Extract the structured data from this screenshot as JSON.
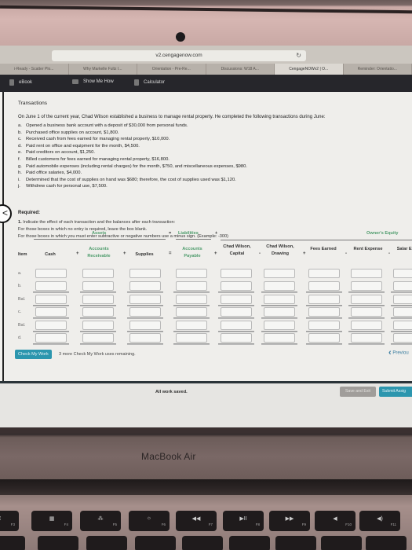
{
  "browser": {
    "url": "v2.cengagenow.com",
    "tabs": [
      {
        "label": "i-Ready - Scatter Plo...",
        "active": false
      },
      {
        "label": "Why Markelle Fultz I...",
        "active": false
      },
      {
        "label": "Orientation - Pre-Re...",
        "active": false
      },
      {
        "label": "Discussions: W18 A...",
        "active": false
      },
      {
        "label": "CengageNOWv2 | O...",
        "active": true
      },
      {
        "label": "Reminder: Orientatio...",
        "active": false
      }
    ]
  },
  "toolbar": {
    "ebook": "eBook",
    "show_me_how": "Show Me How",
    "calculator": "Calculator"
  },
  "problem": {
    "title": "Transactions",
    "intro": "On June 1 of the current year, Chad Wilson established a business to manage rental property. He completed the following transactions during June:",
    "transactions": [
      {
        "letter": "a.",
        "text": "Opened a business bank account with a deposit of $30,000 from personal funds."
      },
      {
        "letter": "b.",
        "text": "Purchased office supplies on account, $1,800."
      },
      {
        "letter": "c.",
        "text": "Received cash from fees earned for managing rental property, $10,000."
      },
      {
        "letter": "d.",
        "text": "Paid rent on office and equipment for the month, $4,500."
      },
      {
        "letter": "e.",
        "text": "Paid creditors on account, $1,250."
      },
      {
        "letter": "f.",
        "text": "Billed customers for fees earned for managing rental property, $16,800."
      },
      {
        "letter": "g.",
        "text": "Paid automobile expenses (including rental charges) for the month, $750, and miscellaneous expenses, $980."
      },
      {
        "letter": "h.",
        "text": "Paid office salaries, $4,000."
      },
      {
        "letter": "i.",
        "text": "Determined that the cost of supplies on hand was $680; therefore, the cost of supplies used was $1,120."
      },
      {
        "letter": "j.",
        "text": "Withdrew cash for personal use, $7,500."
      }
    ],
    "required_label": "Required:",
    "instruction_number": "1.",
    "instruction": "Indicate the effect of each transaction and the balances after each transaction:",
    "note1": "For those boxes in which no entry is required, leave the box blank.",
    "note2": "For those boxes in which you must enter subtractive or negative numbers use a minus sign. (Example: -300)"
  },
  "equation": {
    "assets": "Assets",
    "equals": "=",
    "liabilities": "Liabilities",
    "plus": "+",
    "owners_equity": "Owner's Equity",
    "columns": [
      {
        "label": "Item"
      },
      {
        "label": "Cash"
      },
      {
        "label": "Accounts Receivable"
      },
      {
        "label": "Supplies"
      },
      {
        "label": "Accounts Payable"
      },
      {
        "label": "Chad Wilson, Capital"
      },
      {
        "label": "Chad Wilson, Drawing"
      },
      {
        "label": "Fees Earned"
      },
      {
        "label": "Rent Expense"
      },
      {
        "label": "Salar Expe"
      }
    ],
    "operators": [
      "+",
      "+",
      "=",
      "+",
      "-",
      "+",
      "-",
      "-"
    ],
    "rows": [
      {
        "label": "a.",
        "values": [
          "",
          "",
          "",
          "",
          "",
          "",
          "",
          "",
          ""
        ]
      },
      {
        "label": "b.",
        "values": [
          "",
          "",
          "",
          "",
          "",
          "",
          "",
          "",
          ""
        ]
      },
      {
        "label": "Bal.",
        "values": [
          "",
          "",
          "",
          "",
          "",
          "",
          "",
          "",
          ""
        ]
      },
      {
        "label": "c.",
        "values": [
          "",
          "",
          "",
          "",
          "",
          "",
          "",
          "",
          ""
        ]
      },
      {
        "label": "Bal.",
        "values": [
          "",
          "",
          "",
          "",
          "",
          "",
          "",
          "",
          ""
        ]
      },
      {
        "label": "d.",
        "values": [
          "",
          "",
          "",
          "",
          "",
          "",
          "",
          "",
          ""
        ]
      }
    ]
  },
  "actions": {
    "check_my_work": "Check My Work",
    "remaining": "3 more Check My Work uses remaining.",
    "previous": "Previou"
  },
  "footer": {
    "status": "All work saved.",
    "save_exit": "Save and Exit",
    "submit": "Submit Assig"
  },
  "device": {
    "brand": "MacBook Air",
    "keys": [
      {
        "glyph": "⌘",
        "fn": "F3"
      },
      {
        "glyph": "▦",
        "fn": "F4"
      },
      {
        "glyph": "⁂",
        "fn": "F5"
      },
      {
        "glyph": "☼",
        "fn": "F6"
      },
      {
        "glyph": "◀◀",
        "fn": "F7"
      },
      {
        "glyph": "▶II",
        "fn": "F8"
      },
      {
        "glyph": "▶▶",
        "fn": "F9"
      },
      {
        "glyph": "◀",
        "fn": "F10"
      },
      {
        "glyph": "◀)",
        "fn": "F11"
      }
    ]
  },
  "colors": {
    "accent_teal": "#2c96ae",
    "equation_green": "#4d9b6b",
    "toolbar_dark": "#26262b"
  }
}
